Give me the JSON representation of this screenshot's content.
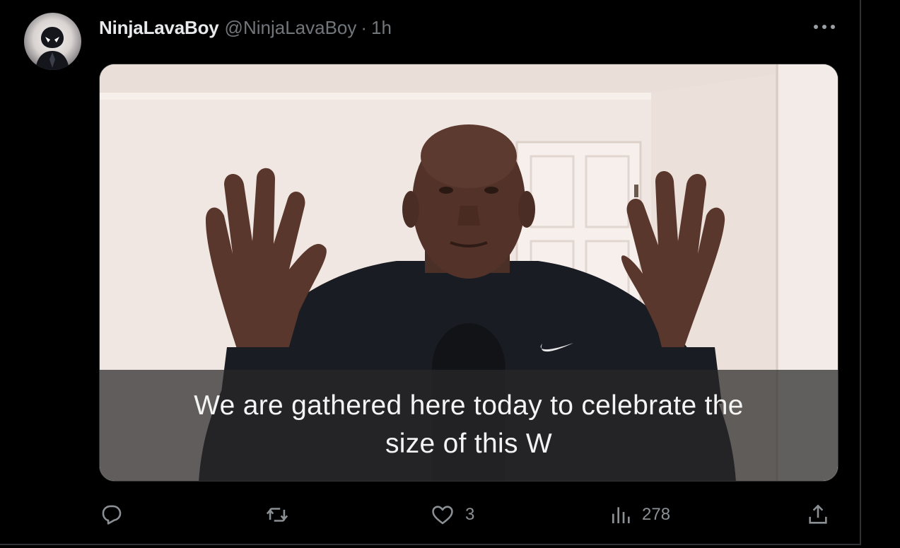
{
  "tweet": {
    "author": {
      "display_name": "NinjaLavaBoy",
      "handle": "@NinjaLavaBoy",
      "avatar_icon": "spiderman-avatar-icon"
    },
    "separator": "·",
    "timestamp": "1h",
    "more_icon": "more-dots-icon",
    "media": {
      "caption_lines": [
        "We are gathered here today to celebrate the",
        "size of this W"
      ]
    },
    "actions": {
      "reply": {
        "icon": "reply-icon"
      },
      "retweet": {
        "icon": "retweet-icon"
      },
      "like": {
        "icon": "heart-icon",
        "count": "3"
      },
      "views": {
        "icon": "views-chart-icon",
        "count": "278"
      },
      "share": {
        "icon": "share-icon"
      }
    }
  },
  "colors": {
    "background": "#000000",
    "primary_text": "#e7e9ea",
    "secondary_text": "#71767b",
    "border": "#2f3336"
  }
}
